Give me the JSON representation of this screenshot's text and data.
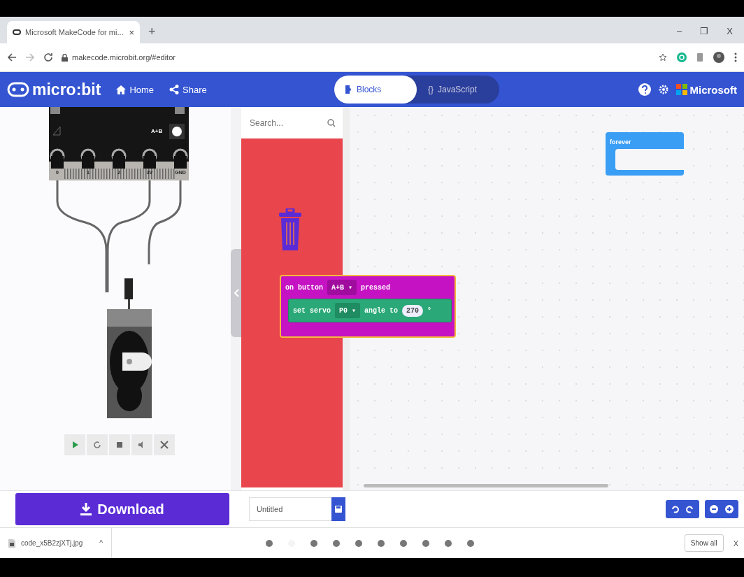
{
  "browser": {
    "tab": {
      "title": "Microsoft MakeCode for mi...",
      "close": "×"
    },
    "new_tab": "+",
    "window_controls": [
      "–",
      "❐",
      "X"
    ],
    "url": "makecode.microbit.org/#editor"
  },
  "header": {
    "logo": "micro:bit",
    "nav": [
      {
        "kind": "home",
        "label": "Home"
      },
      {
        "kind": "share",
        "label": "Share"
      }
    ],
    "tabs": [
      {
        "kind": "blocks",
        "label": "Blocks",
        "selected": true
      },
      {
        "kind": "javascript",
        "icon": "{}",
        "label": "JavaScript",
        "selected": false
      }
    ],
    "brand": "Microsoft"
  },
  "simulator": {
    "button_label": "A+B",
    "pins": [
      "0",
      "1",
      "2",
      "3V",
      "GND"
    ],
    "controls": [
      {
        "kind": "play"
      },
      {
        "kind": "restart"
      },
      {
        "kind": "stop"
      },
      {
        "kind": "mute"
      },
      {
        "kind": "fullscreen"
      }
    ]
  },
  "toolbox": {
    "search": {
      "placeholder": "Search..."
    }
  },
  "workspace": {
    "blocks": [
      {
        "kind": "event",
        "label": "on button",
        "dropdown": "A+B ▾",
        "suffix": "pressed",
        "selected": true,
        "children": [
          {
            "kind": "statement",
            "label": "set servo",
            "dropdown": "P0 ▾",
            "middle": "angle to",
            "value": "270",
            "unit": "°"
          }
        ]
      },
      {
        "kind": "loop",
        "label": "forever",
        "selected": false
      }
    ]
  },
  "bottom_bar": {
    "download": "Download",
    "project_name": "Untitled"
  },
  "download_shelf": {
    "file": "code_x5B2zjXTj.jpg",
    "caret": "^",
    "show_all": "Show all",
    "close": "X"
  },
  "page_dots": [
    {
      "selected": false
    },
    {
      "selected": true
    },
    {
      "selected": false
    },
    {
      "selected": false
    },
    {
      "selected": false
    },
    {
      "selected": false
    },
    {
      "selected": false
    },
    {
      "selected": false
    },
    {
      "selected": false
    },
    {
      "selected": false
    }
  ]
}
